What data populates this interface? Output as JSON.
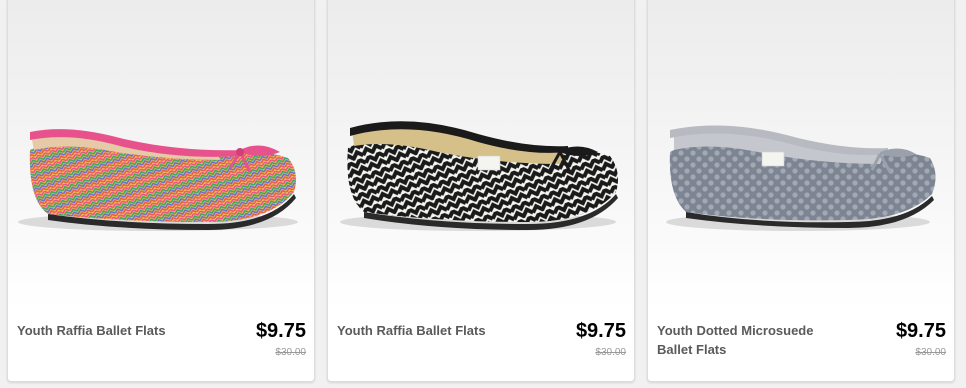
{
  "products": [
    {
      "name": "Youth Raffia Ballet Flats",
      "price": "$9.75",
      "old_price": "$30.00",
      "colors": [
        "#e8528c",
        "#3aa66a",
        "#e55a5a",
        "#f2c04a",
        "#6a6ed0"
      ]
    },
    {
      "name": "Youth Raffia Ballet Flats",
      "price": "$9.75",
      "old_price": "$30.00",
      "colors": [
        "#1a1a1a",
        "#f4f4f0"
      ]
    },
    {
      "name": "Youth Dotted Microsuede Ballet Flats",
      "price": "$9.75",
      "old_price": "$30.00",
      "colors": [
        "#7d8593",
        "#c4c8ce"
      ]
    }
  ]
}
